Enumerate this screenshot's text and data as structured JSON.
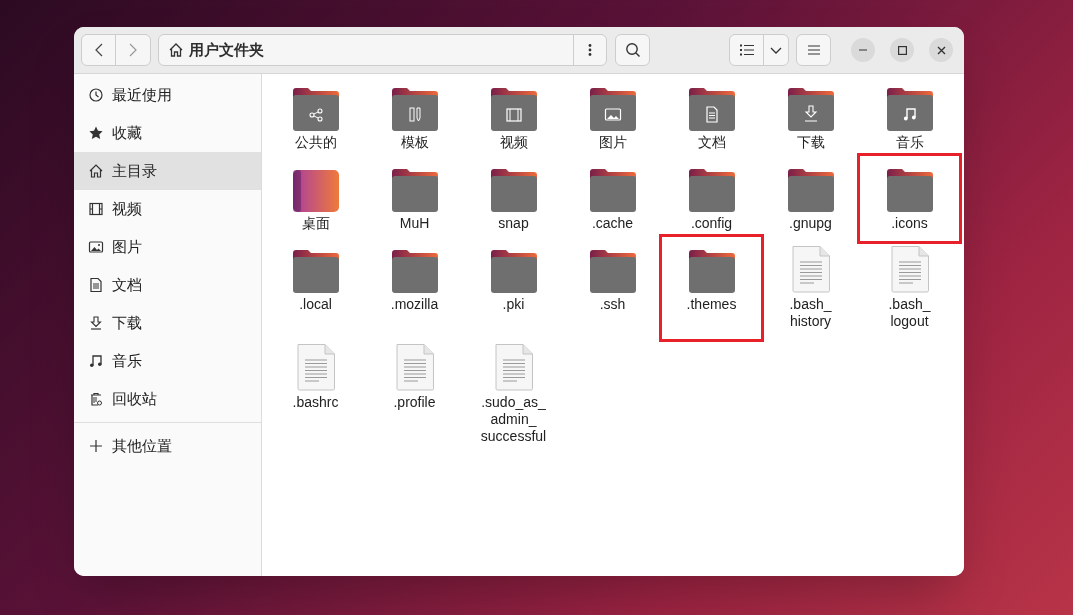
{
  "window": {
    "path": "用户文件夹"
  },
  "sidebar": {
    "items": [
      {
        "kind": "recent",
        "label": "最近使用",
        "selected": false
      },
      {
        "kind": "starred",
        "label": "收藏",
        "selected": false
      },
      {
        "kind": "home",
        "label": "主目录",
        "selected": true
      },
      {
        "kind": "videos",
        "label": "视频",
        "selected": false
      },
      {
        "kind": "pictures",
        "label": "图片",
        "selected": false
      },
      {
        "kind": "documents",
        "label": "文档",
        "selected": false
      },
      {
        "kind": "downloads",
        "label": "下载",
        "selected": false
      },
      {
        "kind": "music",
        "label": "音乐",
        "selected": false
      },
      {
        "kind": "trash",
        "label": "回收站",
        "selected": false
      },
      {
        "kind": "other",
        "label": "其他位置",
        "selected": false
      }
    ]
  },
  "files": [
    {
      "kind": "public",
      "name": "公共的",
      "highlighted": false
    },
    {
      "kind": "templates",
      "name": "模板",
      "highlighted": false
    },
    {
      "kind": "videos",
      "name": "视频",
      "highlighted": false
    },
    {
      "kind": "pictures",
      "name": "图片",
      "highlighted": false
    },
    {
      "kind": "documents",
      "name": "文档",
      "highlighted": false
    },
    {
      "kind": "downloads",
      "name": "下载",
      "highlighted": false
    },
    {
      "kind": "music",
      "name": "音乐",
      "highlighted": false
    },
    {
      "kind": "desktop",
      "name": "桌面",
      "highlighted": false
    },
    {
      "kind": "folder",
      "name": "MuH",
      "highlighted": false
    },
    {
      "kind": "folder",
      "name": "snap",
      "highlighted": false
    },
    {
      "kind": "folder",
      "name": ".cache",
      "highlighted": false
    },
    {
      "kind": "folder",
      "name": ".config",
      "highlighted": false
    },
    {
      "kind": "folder",
      "name": ".gnupg",
      "highlighted": false
    },
    {
      "kind": "folder",
      "name": ".icons",
      "highlighted": true
    },
    {
      "kind": "folder",
      "name": ".local",
      "highlighted": false
    },
    {
      "kind": "folder",
      "name": ".mozilla",
      "highlighted": false
    },
    {
      "kind": "folder",
      "name": ".pki",
      "highlighted": false
    },
    {
      "kind": "folder",
      "name": ".ssh",
      "highlighted": false
    },
    {
      "kind": "folder",
      "name": ".themes",
      "highlighted": true
    },
    {
      "kind": "file",
      "name": ".bash_history",
      "highlighted": false
    },
    {
      "kind": "file",
      "name": ".bash_logout",
      "highlighted": false
    },
    {
      "kind": "file",
      "name": ".bashrc",
      "highlighted": false
    },
    {
      "kind": "file",
      "name": ".profile",
      "highlighted": false
    },
    {
      "kind": "file",
      "name": ".sudo_as_admin_successful",
      "highlighted": false
    }
  ]
}
